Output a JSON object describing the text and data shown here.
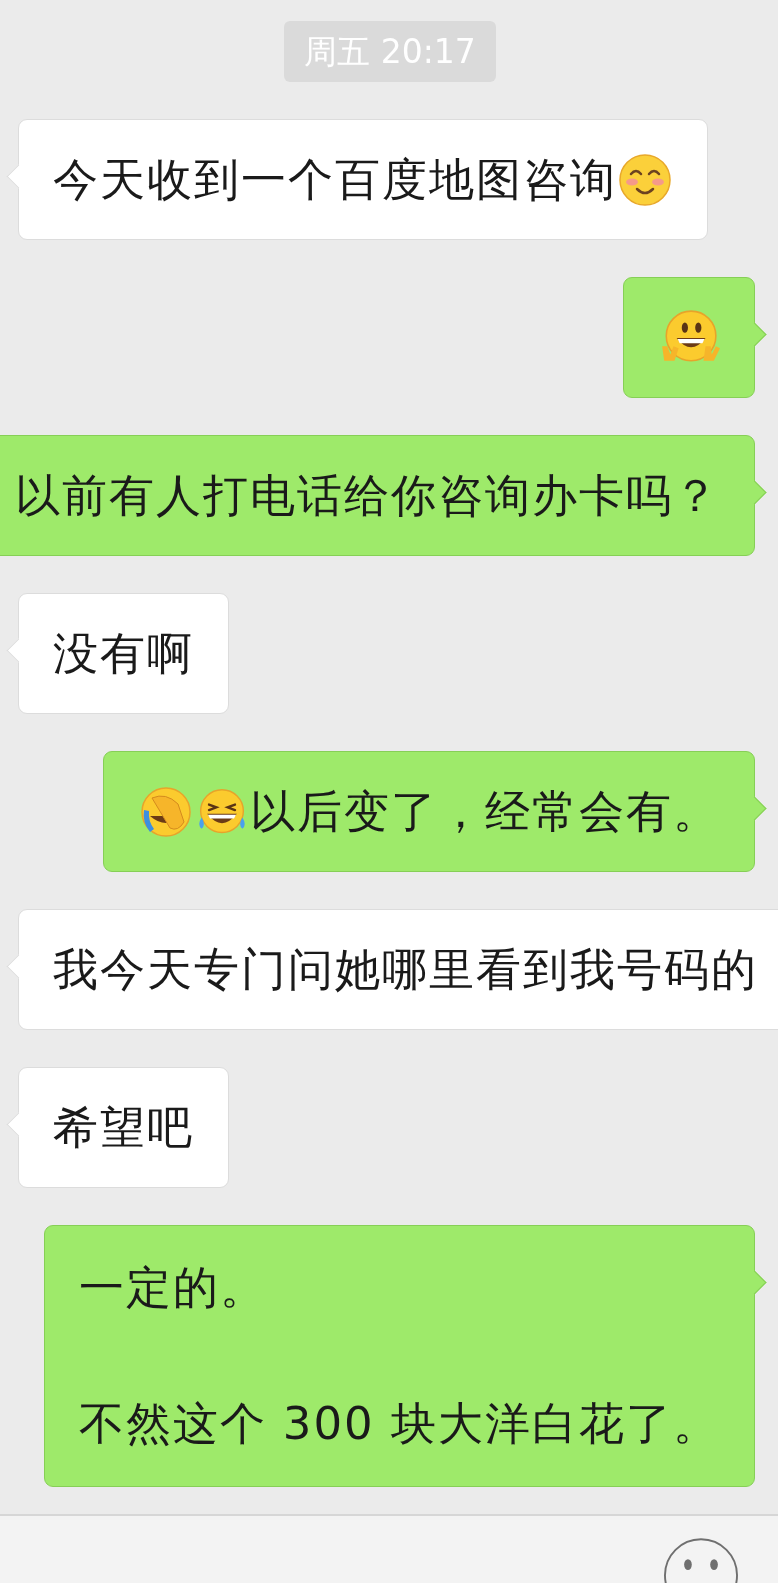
{
  "timestamp": "周五 20:17",
  "messages": [
    {
      "outgoing": false,
      "parts": [
        {
          "kind": "text",
          "text": "今天收到一个百度地图咨询"
        },
        {
          "kind": "blush-emoji"
        }
      ]
    },
    {
      "outgoing": true,
      "parts": [
        {
          "kind": "peace-emoji"
        }
      ]
    },
    {
      "outgoing": true,
      "parts": [
        {
          "kind": "text",
          "text": "以前有人打电话给你咨询办卡吗？"
        }
      ]
    },
    {
      "outgoing": false,
      "parts": [
        {
          "kind": "text",
          "text": "没有啊"
        }
      ]
    },
    {
      "outgoing": true,
      "parts": [
        {
          "kind": "facepalm-emoji"
        },
        {
          "kind": "tears-emoji"
        },
        {
          "kind": "text",
          "text": "以后变了，经常会有。"
        }
      ]
    },
    {
      "outgoing": false,
      "parts": [
        {
          "kind": "text",
          "text": "我今天专门问她哪里看到我号码的"
        }
      ]
    },
    {
      "outgoing": false,
      "parts": [
        {
          "kind": "text",
          "text": "希望吧"
        }
      ]
    },
    {
      "outgoing": true,
      "paragraphs": [
        "一定的。",
        "不然这个 300 块大洋白花了。"
      ]
    }
  ]
}
